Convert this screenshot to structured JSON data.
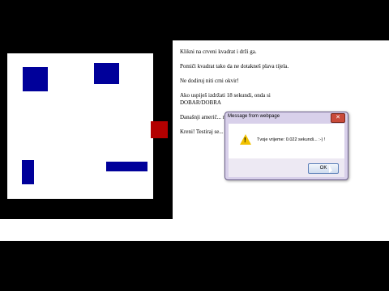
{
  "instructions": [
    "Klikni na crveni kvadrat i drži ga.",
    "Pomiči kvadrat tako da ne dotakneš plava tijela.",
    "Ne dodiruj niti crni okvir!",
    "Ako uspiješ izdržati 18 sekundi, onda si DOBAR/DOBRA",
    "Današnji američ... najmanje 2 minu...",
    "Kreni! Testiraj se... rezultat."
  ],
  "dialog": {
    "title": "Message from webpage",
    "close_label": "✕",
    "message": "Tvoje vrijeme: 0.022 sekundi... :-) !",
    "warn_symbol": "!",
    "ok_label": "OK"
  },
  "colors": {
    "blue_block": "#00009a",
    "red_square": "#b30000",
    "frame": "#000000"
  }
}
